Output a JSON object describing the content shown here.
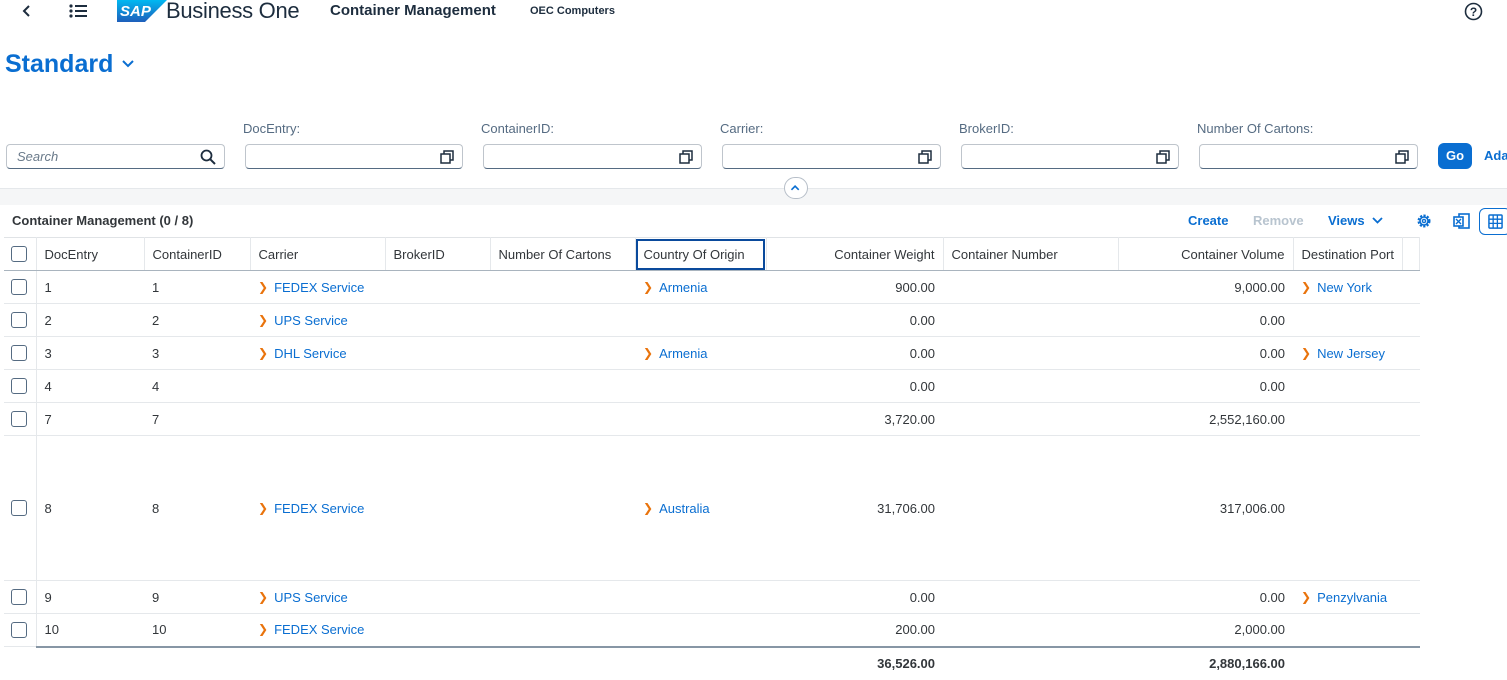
{
  "shell": {
    "brand": "Business One",
    "logo_text": "SAP",
    "app_title": "Container Management",
    "company": "OEC Computers"
  },
  "variant": {
    "name": "Standard"
  },
  "filters": {
    "search_placeholder": "Search",
    "fields": [
      {
        "label": "DocEntry:",
        "value": ""
      },
      {
        "label": "ContainerID:",
        "value": ""
      },
      {
        "label": "Carrier:",
        "value": ""
      },
      {
        "label": "BrokerID:",
        "value": ""
      },
      {
        "label": "Number Of Cartons:",
        "value": ""
      }
    ],
    "go_label": "Go",
    "adapt_label": "Ada"
  },
  "table": {
    "title": "Container Management (0 / 8)",
    "toolbar": {
      "create": "Create",
      "remove": "Remove",
      "views": "Views"
    },
    "columns": [
      "DocEntry",
      "ContainerID",
      "Carrier",
      "BrokerID",
      "Number Of Cartons",
      "Country Of Origin",
      "Container Weight",
      "Container Number",
      "Container Volume",
      "Destination Port"
    ],
    "rows": [
      {
        "doc_entry": "1",
        "container_id": "1",
        "carrier": "FEDEX Service",
        "broker_id": "",
        "cartons": "",
        "country": "Armenia",
        "weight": "900.00",
        "number": "",
        "volume": "9,000.00",
        "port": "New York"
      },
      {
        "doc_entry": "2",
        "container_id": "2",
        "carrier": "UPS Service",
        "broker_id": "",
        "cartons": "",
        "country": "",
        "weight": "0.00",
        "number": "",
        "volume": "0.00",
        "port": ""
      },
      {
        "doc_entry": "3",
        "container_id": "3",
        "carrier": "DHL Service",
        "broker_id": "",
        "cartons": "",
        "country": "Armenia",
        "weight": "0.00",
        "number": "",
        "volume": "0.00",
        "port": "New Jersey"
      },
      {
        "doc_entry": "4",
        "container_id": "4",
        "carrier": "",
        "broker_id": "",
        "cartons": "",
        "country": "",
        "weight": "0.00",
        "number": "",
        "volume": "0.00",
        "port": ""
      },
      {
        "doc_entry": "7",
        "container_id": "7",
        "carrier": "",
        "broker_id": "",
        "cartons": "",
        "country": "",
        "weight": "3,720.00",
        "number": "",
        "volume": "2,552,160.00",
        "port": ""
      },
      {
        "doc_entry": "8",
        "container_id": "8",
        "carrier": "FEDEX Service",
        "broker_id": "",
        "cartons": "",
        "country": "Australia",
        "weight": "31,706.00",
        "number": "",
        "volume": "317,006.00",
        "port": ""
      },
      {
        "doc_entry": "9",
        "container_id": "9",
        "carrier": "UPS Service",
        "broker_id": "",
        "cartons": "",
        "country": "",
        "weight": "0.00",
        "number": "",
        "volume": "0.00",
        "port": "Penzylvania"
      },
      {
        "doc_entry": "10",
        "container_id": "10",
        "carrier": "FEDEX Service",
        "broker_id": "",
        "cartons": "",
        "country": "",
        "weight": "200.00",
        "number": "",
        "volume": "2,000.00",
        "port": ""
      }
    ],
    "totals": {
      "weight": "36,526.00",
      "volume": "2,880,166.00"
    }
  }
}
